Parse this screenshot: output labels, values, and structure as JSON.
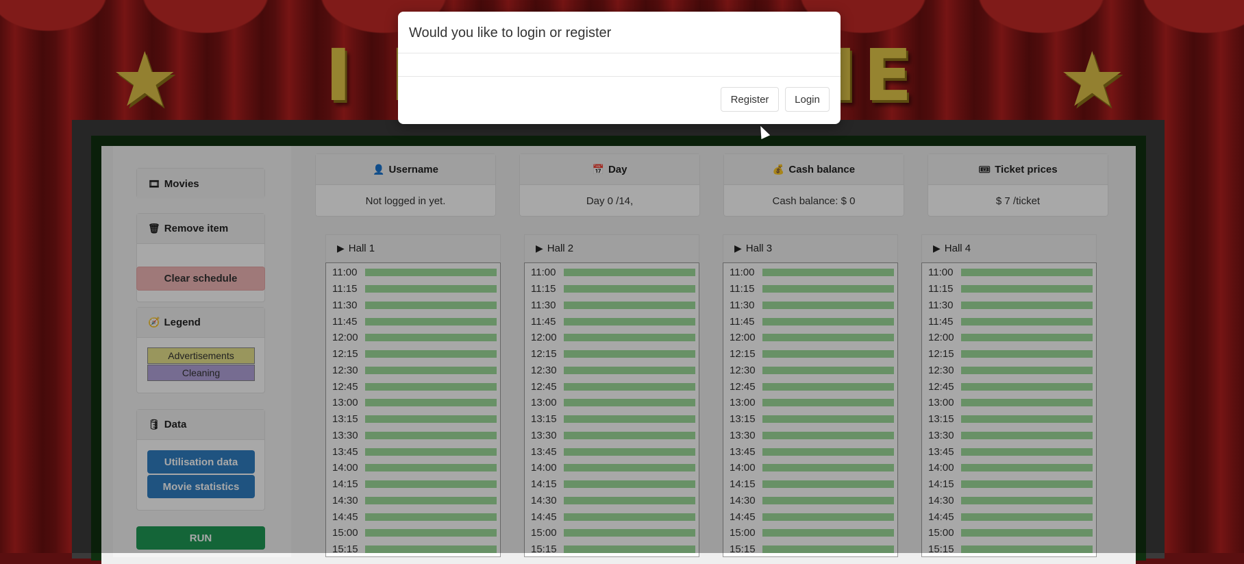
{
  "banner": {
    "title": "I LIKE  MOVIE"
  },
  "sidebar": {
    "movies_label": "Movies",
    "remove_item_label": "Remove item",
    "clear_schedule_label": "Clear schedule",
    "legend_label": "Legend",
    "legend_items": [
      "Advertisements",
      "Cleaning"
    ],
    "data_label": "Data",
    "utilisation_label": "Utilisation data",
    "movie_stats_label": "Movie statistics",
    "run_label": "RUN"
  },
  "info": {
    "username": {
      "label": "Username",
      "value": "Not logged in yet."
    },
    "day": {
      "label": "Day",
      "value": "Day 0 /14,"
    },
    "cash": {
      "label": "Cash balance",
      "value": "Cash balance: $ 0"
    },
    "ticket": {
      "label": "Ticket prices",
      "value": "$ 7 /ticket"
    }
  },
  "halls": [
    {
      "label": "Hall 1"
    },
    {
      "label": "Hall 2"
    },
    {
      "label": "Hall 3"
    },
    {
      "label": "Hall 4"
    }
  ],
  "times": [
    "11:00",
    "11:15",
    "11:30",
    "11:45",
    "12:00",
    "12:15",
    "12:30",
    "12:45",
    "13:00",
    "13:15",
    "13:30",
    "13:45",
    "14:00",
    "14:15",
    "14:30",
    "14:45",
    "15:00",
    "15:15"
  ],
  "modal": {
    "title": "Would you like to login or register",
    "register_label": "Register",
    "login_label": "Login"
  },
  "colors": {
    "slot_free": "#9fdc9b",
    "advertisements": "#e9e48d",
    "cleaning": "#b3a5dd",
    "clear_schedule": "#f2b8b8",
    "data_button": "#2f7fc2",
    "run_button": "#1f9a55"
  }
}
